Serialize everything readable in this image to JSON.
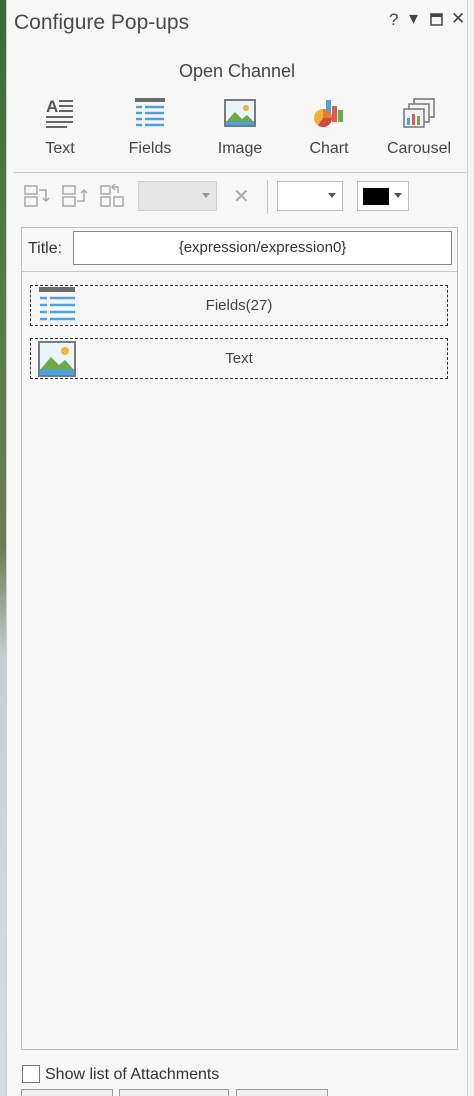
{
  "window": {
    "title": "Configure Pop-ups",
    "help_glyph": "?",
    "menu_glyph": "▾",
    "maximize_glyph": "⧠",
    "close_glyph": "✕"
  },
  "layer_name": "Open Channel",
  "toolbar_items": [
    {
      "label": "Text",
      "icon": "text-icon"
    },
    {
      "label": "Fields",
      "icon": "fields-icon"
    },
    {
      "label": "Image",
      "icon": "image-icon"
    },
    {
      "label": "Chart",
      "icon": "chart-icon"
    },
    {
      "label": "Carousel",
      "icon": "carousel-icon"
    }
  ],
  "format_toolbar": {
    "delete_glyph": "✕",
    "font_combo_value": "",
    "size_combo_value": "",
    "text_color": "#000000"
  },
  "title_label": "Title:",
  "title_value": "{expression/expression0}",
  "elements": [
    {
      "label": "Fields(27)",
      "icon": "fields-icon"
    },
    {
      "label": "Text",
      "icon": "image-icon"
    }
  ],
  "attachments_label": "Show list of Attachments",
  "attachments_checked": false
}
